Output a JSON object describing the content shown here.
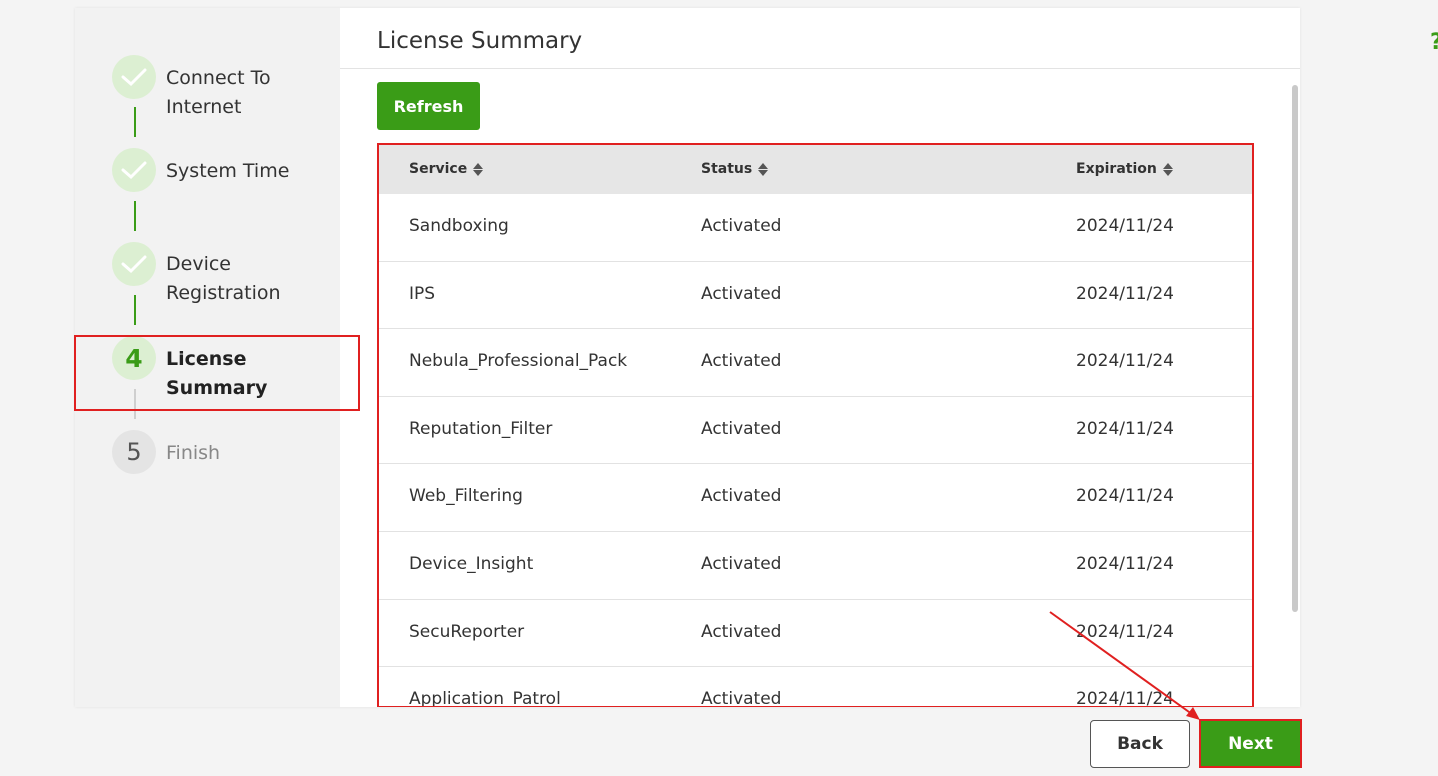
{
  "steps": [
    {
      "label": "Connect To\nInternet",
      "state": "done"
    },
    {
      "label": "System Time",
      "state": "done"
    },
    {
      "label": "Device\nRegistration",
      "state": "done"
    },
    {
      "label": "License\nSummary",
      "state": "active",
      "number": "4"
    },
    {
      "label": "Finish",
      "state": "pending",
      "number": "5"
    }
  ],
  "main": {
    "title": "License Summary",
    "refresh_label": "Refresh"
  },
  "table": {
    "headers": [
      "Service",
      "Status",
      "Expiration"
    ],
    "rows": [
      [
        "Sandboxing",
        "Activated",
        "2024/11/24"
      ],
      [
        "IPS",
        "Activated",
        "2024/11/24"
      ],
      [
        "Nebula_Professional_Pack",
        "Activated",
        "2024/11/24"
      ],
      [
        "Reputation_Filter",
        "Activated",
        "2024/11/24"
      ],
      [
        "Web_Filtering",
        "Activated",
        "2024/11/24"
      ],
      [
        "Device_Insight",
        "Activated",
        "2024/11/24"
      ],
      [
        "SecuReporter",
        "Activated",
        "2024/11/24"
      ],
      [
        "Application_Patrol",
        "Activated",
        "2024/11/24"
      ]
    ]
  },
  "footer": {
    "back_label": "Back",
    "next_label": "Next"
  },
  "help_glyph": "?",
  "colors": {
    "accent": "#3a9c17",
    "highlight": "#e02020"
  },
  "icons": {
    "done_step": "check-icon",
    "sort": "sort-icon"
  }
}
